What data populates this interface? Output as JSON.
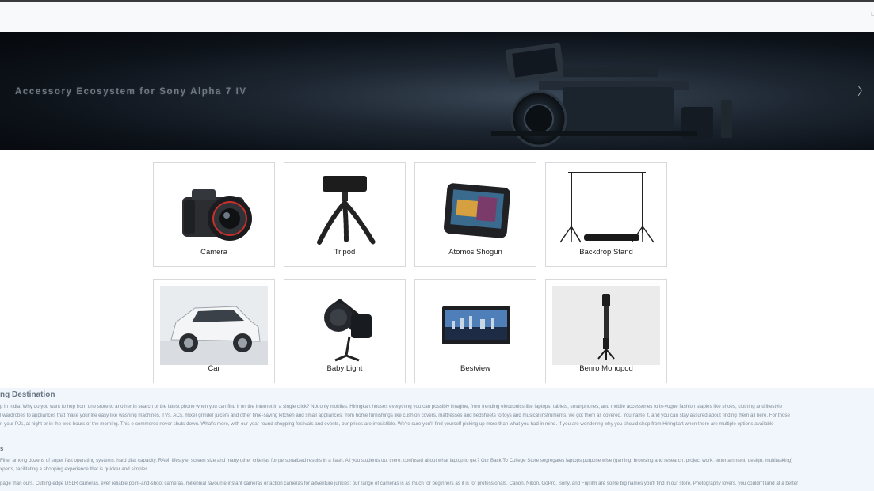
{
  "header": {
    "right_text": "L"
  },
  "hero": {
    "title": "Accessory Ecosystem for Sony Alpha 7 IV",
    "next_glyph": "〉"
  },
  "categories": [
    {
      "label": "Camera"
    },
    {
      "label": "Tripod"
    },
    {
      "label": "Atomos Shogun"
    },
    {
      "label": "Backdrop Stand"
    },
    {
      "label": "Car"
    },
    {
      "label": "Baby Light"
    },
    {
      "label": "Bestview"
    },
    {
      "label": "Benro Monopod"
    }
  ],
  "info": {
    "heading": "ng Destination",
    "lines": [
      "p in India. Why do you want to hop from one store to another in search of the latest phone when you can find it on the Internet in a single click? Not only mobiles. Hiringkart houses everything you can possibly imagine, from trending electronics like laptops, tablets, smartphones, and mobile accessories to in-vogue fashion staples like shoes, clothing and lifestyle",
      "l wardrobes to appliances that make your life easy like washing machines, TVs, ACs, mixer grinder juicers and other time-saving kitchen and small appliances; from home furnishings like cushion covers, mattresses and bedsheets to toys and musical instruments, we got them all covered. You name it, and you can stay assured about finding them all here. For those",
      "n your PJs, at night or in the wee hours of the morning. This e-commerce never shuts down. What's more, with our year-round shopping festivals and events, our prices are irresistible. We're sure you'll find yourself picking up more than what you had in mind. If you are wondering why you should shop from Hiringkart when there are multiple options available"
    ],
    "subheading": "s",
    "lines2": [
      "Filter among dozens of super fast operating systems, hard disk capacity, RAM, lifestyle, screen size and many other criterias for personalized results in a flash. All you students out there, confused about what laptop to get? Our Back To College Store segregates laptops purpose wise (gaming, browsing and research, project work, entertainment, design, multitasking)",
      "xperts, facilitating a shopping experience that is quicker and simpler."
    ],
    "lines3": [
      "page than ours. Cutting-edge DSLR cameras, ever reliable point-and-shoot cameras, millennial favourite instant cameras or action cameras for adventure junkies: our range of cameras is as much for beginners as it is for professionals. Canon, Nikon, GoPro, Sony, and Fujifilm are some big names you'll find in our store. Photography lovers, you couldn't land at a better"
    ]
  }
}
